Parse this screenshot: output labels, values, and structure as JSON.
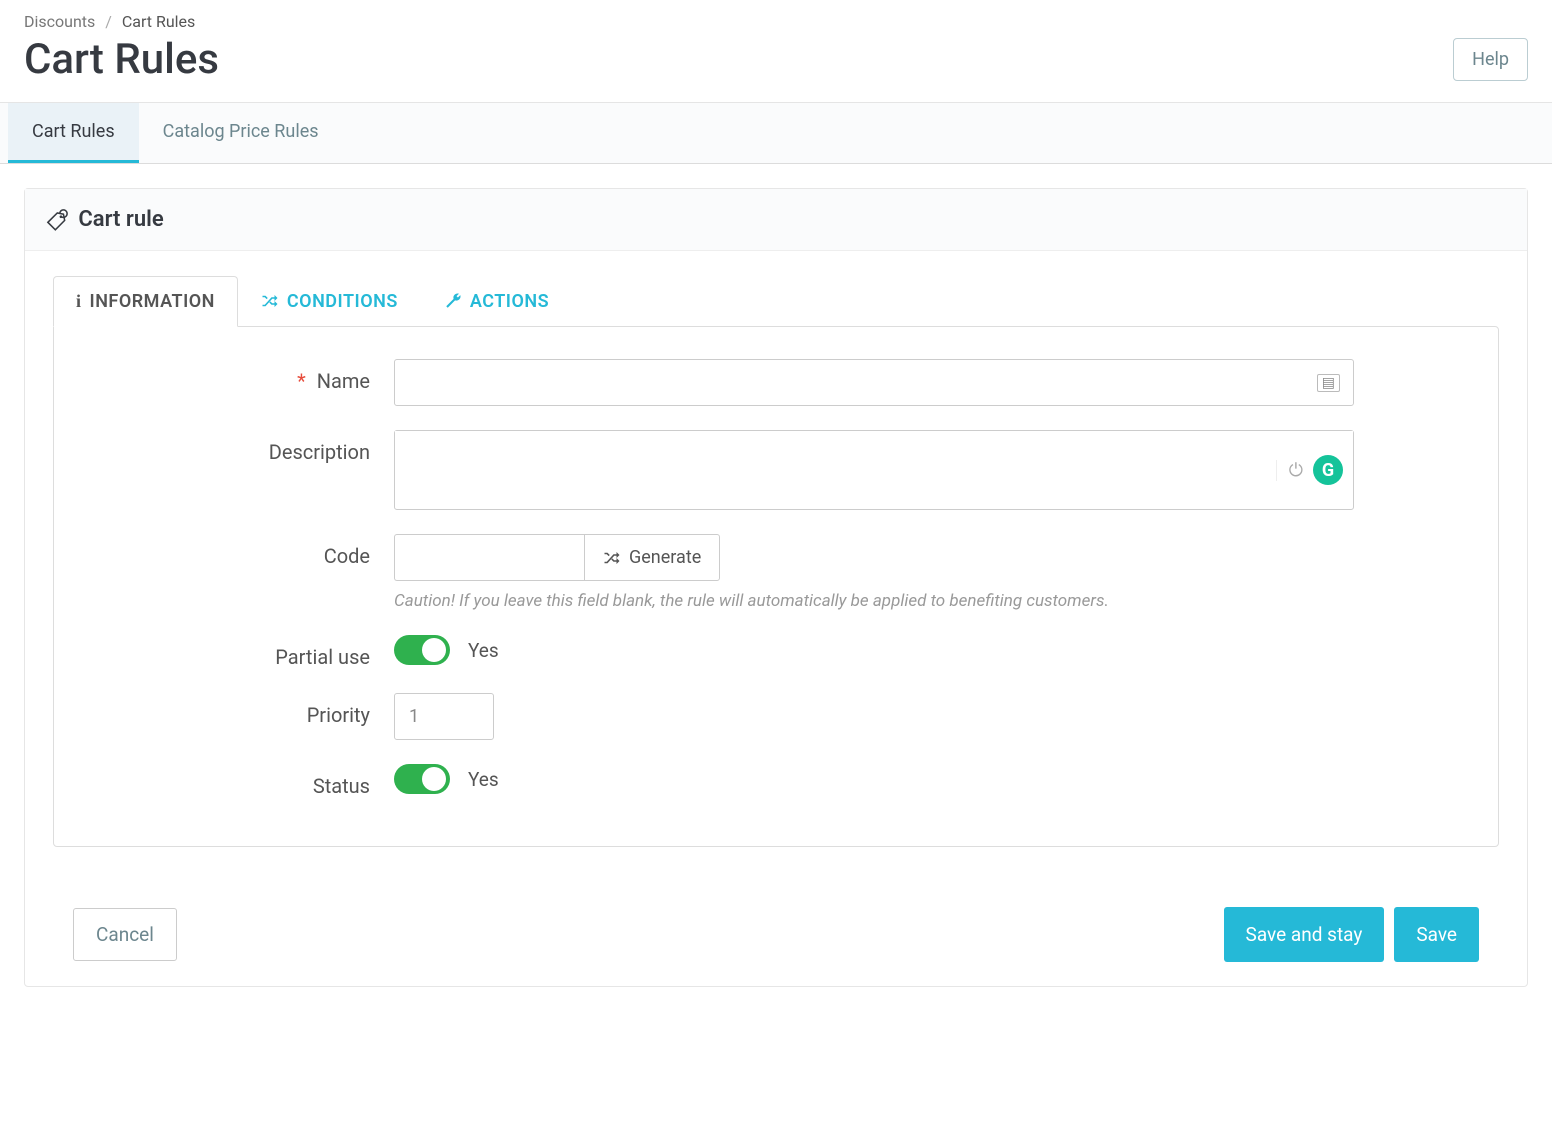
{
  "breadcrumb": {
    "parent": "Discounts",
    "separator": "/",
    "current": "Cart Rules"
  },
  "page_title": "Cart Rules",
  "help_label": "Help",
  "module_tabs": {
    "active": "Cart Rules",
    "inactive": "Catalog Price Rules"
  },
  "panel_title": "Cart rule",
  "inner_tabs": {
    "information": "INFORMATION",
    "conditions": "CONDITIONS",
    "actions": "ACTIONS"
  },
  "form": {
    "name": {
      "label": "Name",
      "value": ""
    },
    "description": {
      "label": "Description",
      "value": ""
    },
    "code": {
      "label": "Code",
      "value": "",
      "generate_label": "Generate",
      "hint": "Caution! If you leave this field blank, the rule will automatically be applied to benefiting customers."
    },
    "partial_use": {
      "label": "Partial use",
      "state_label": "Yes"
    },
    "priority": {
      "label": "Priority",
      "value": "1"
    },
    "status": {
      "label": "Status",
      "state_label": "Yes"
    }
  },
  "footer": {
    "cancel": "Cancel",
    "save_stay": "Save and stay",
    "save": "Save"
  }
}
